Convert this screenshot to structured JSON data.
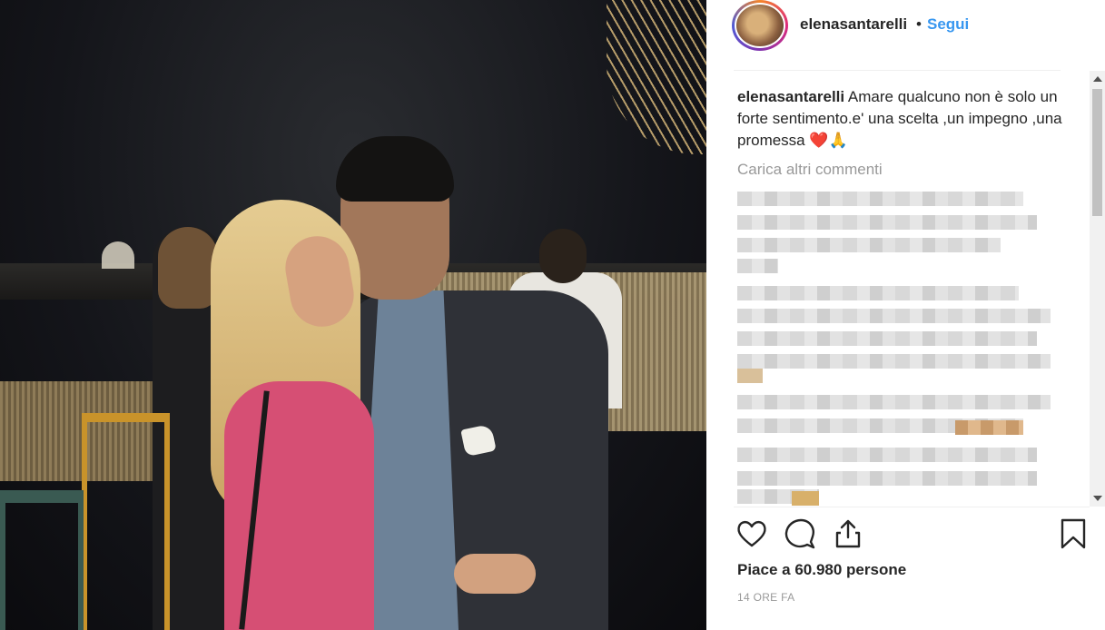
{
  "post": {
    "username": "elenasantarelli",
    "separator": "•",
    "follow_label": "Segui",
    "caption_username": "elenasantarelli",
    "caption_text": "Amare qualcuno non è solo un forte sentimento.e' una scelta ,un impegno ,una promessa",
    "caption_emoji": "❤️🙏",
    "load_more_label": "Carica altri commenti",
    "likes_text": "Piace a 60.980 persone",
    "time_ago": "14 ORE FA"
  },
  "icons": {
    "like": "heart-outline-icon",
    "comment": "speech-bubble-icon",
    "share": "share-upload-icon",
    "save": "bookmark-icon"
  },
  "colors": {
    "link_blue": "#3897f0",
    "text": "#262626",
    "muted": "#999999",
    "heart_red": "#d0021b"
  }
}
